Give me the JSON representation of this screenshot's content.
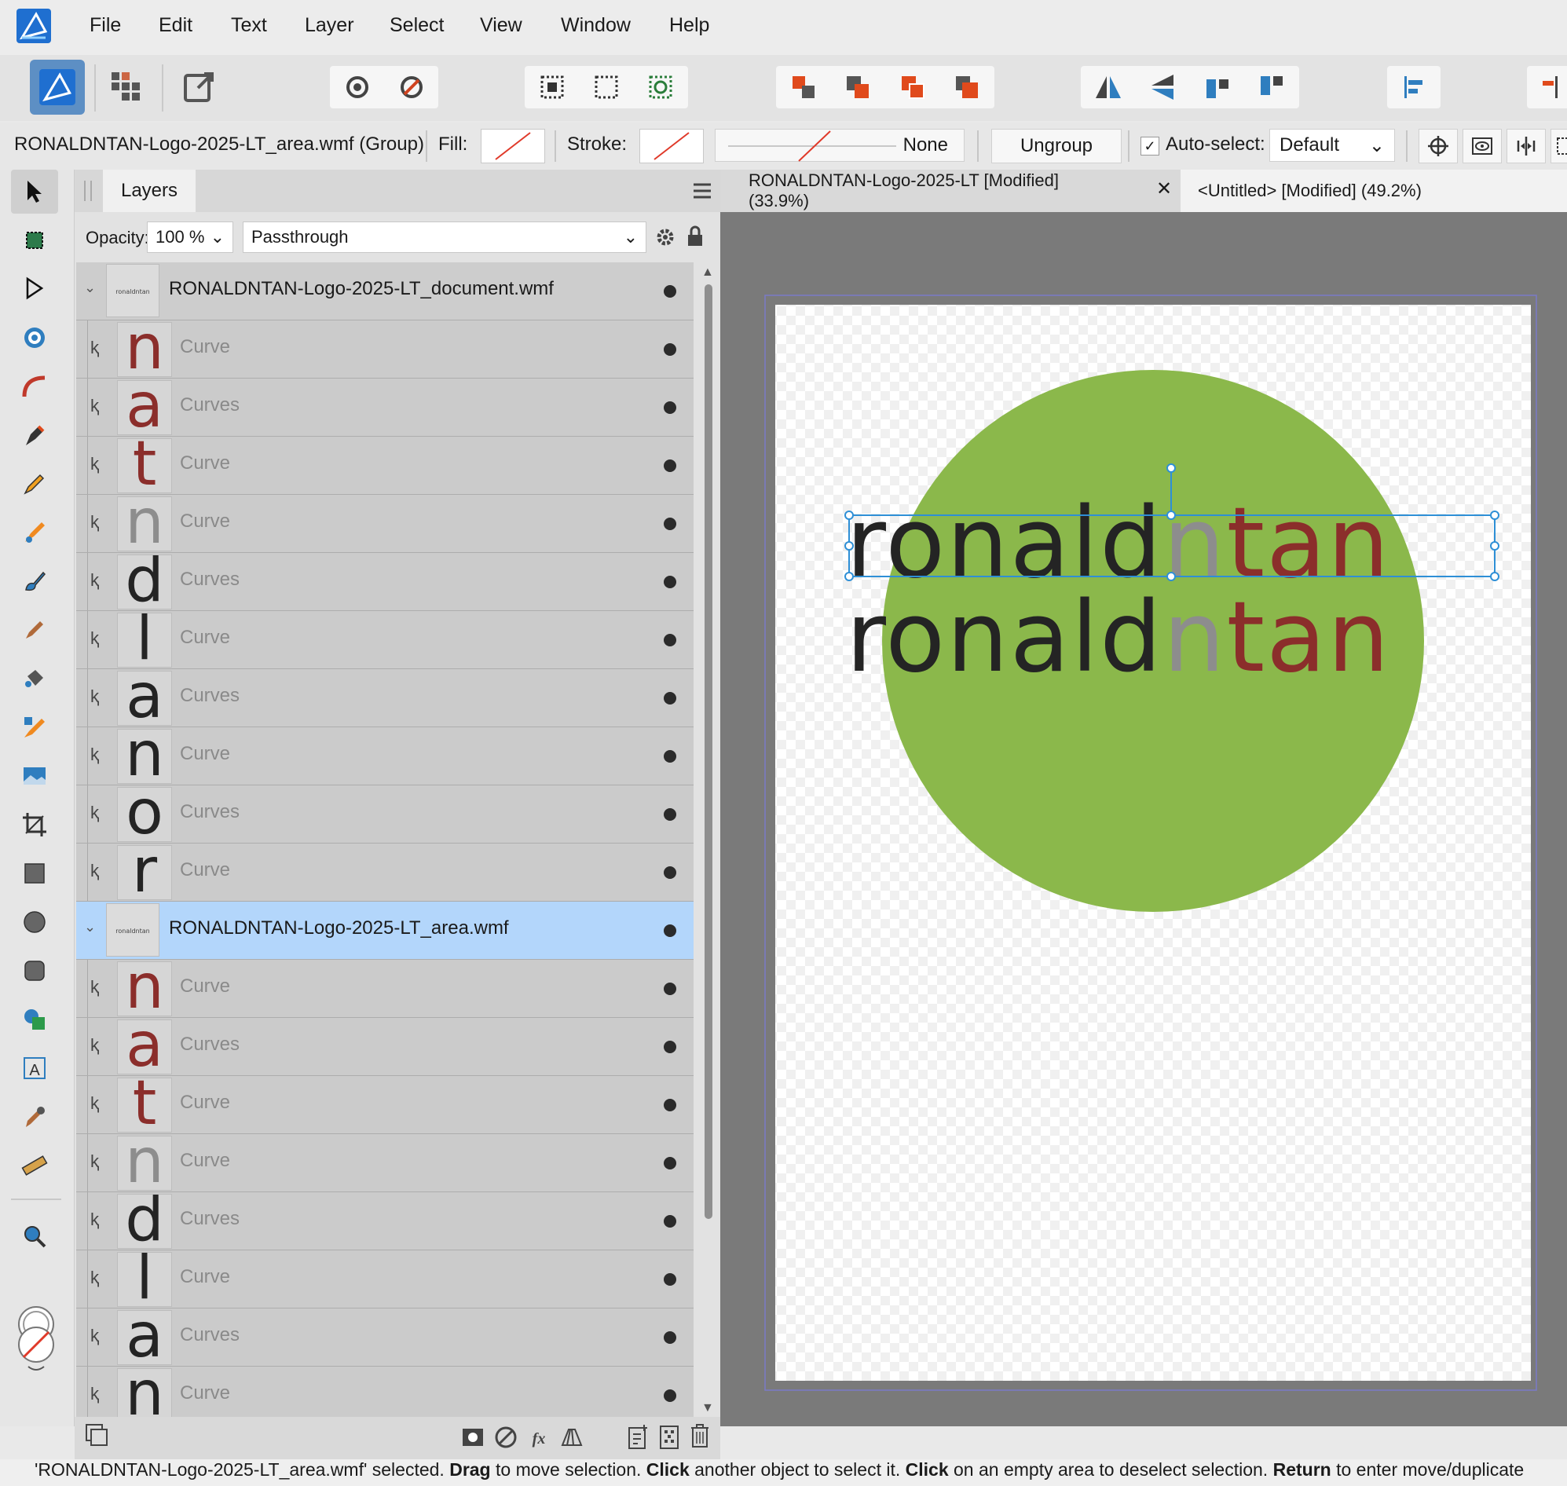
{
  "menu": [
    "File",
    "Edit",
    "Text",
    "Layer",
    "Select",
    "View",
    "Window",
    "Help"
  ],
  "context": {
    "selection": "RONALDNTAN-Logo-2025-LT_area.wmf (Group)",
    "fill_label": "Fill:",
    "stroke_label": "Stroke:",
    "stroke_style": "None",
    "ungroup": "Ungroup",
    "autoselect_label": "Auto-select:",
    "autoselect_value": "Default"
  },
  "layers": {
    "tab": "Layers",
    "opacity_label": "Opacity:",
    "opacity_value": "100 %",
    "blend_mode": "Passthrough",
    "rows": [
      {
        "name": "RONALDNTAN-Logo-2025-LT_document.wmf",
        "kind": "group",
        "thumb_text": "ronaldntan"
      },
      {
        "name": "Curve",
        "kind": "child",
        "glyph": "n",
        "color": "#8b2e2b"
      },
      {
        "name": "Curves",
        "kind": "child",
        "glyph": "a",
        "color": "#8b2e2b"
      },
      {
        "name": "Curve",
        "kind": "child",
        "glyph": "t",
        "color": "#8b2e2b"
      },
      {
        "name": "Curve",
        "kind": "child",
        "glyph": "n",
        "color": "#8d8d8d"
      },
      {
        "name": "Curves",
        "kind": "child",
        "glyph": "d",
        "color": "#242424"
      },
      {
        "name": "Curve",
        "kind": "child",
        "glyph": "l",
        "color": "#242424"
      },
      {
        "name": "Curves",
        "kind": "child",
        "glyph": "a",
        "color": "#242424"
      },
      {
        "name": "Curve",
        "kind": "child",
        "glyph": "n",
        "color": "#242424"
      },
      {
        "name": "Curves",
        "kind": "child",
        "glyph": "o",
        "color": "#242424"
      },
      {
        "name": "Curve",
        "kind": "child",
        "glyph": "r",
        "color": "#242424"
      },
      {
        "name": "RONALDNTAN-Logo-2025-LT_area.wmf",
        "kind": "group",
        "selected": true,
        "thumb_text": "ronaldntan"
      },
      {
        "name": "Curve",
        "kind": "child",
        "glyph": "n",
        "color": "#8b2e2b"
      },
      {
        "name": "Curves",
        "kind": "child",
        "glyph": "a",
        "color": "#8b2e2b"
      },
      {
        "name": "Curve",
        "kind": "child",
        "glyph": "t",
        "color": "#8b2e2b"
      },
      {
        "name": "Curve",
        "kind": "child",
        "glyph": "n",
        "color": "#8d8d8d"
      },
      {
        "name": "Curves",
        "kind": "child",
        "glyph": "d",
        "color": "#242424"
      },
      {
        "name": "Curve",
        "kind": "child",
        "glyph": "l",
        "color": "#242424"
      },
      {
        "name": "Curves",
        "kind": "child",
        "glyph": "a",
        "color": "#242424"
      },
      {
        "name": "Curve",
        "kind": "child",
        "glyph": "n",
        "color": "#242424"
      }
    ]
  },
  "documents": {
    "tab1": "RONALDNTAN-Logo-2025-LT [Modified] (33.9%)",
    "tab2": "<Untitled> [Modified] (49.2%)"
  },
  "artwork": {
    "logo_dark": "ronald",
    "logo_grey": "n",
    "logo_red": "tan",
    "circle_color": "#8bb84b",
    "dark_color": "#242424",
    "grey_color": "#8d8d8d",
    "red_color": "#8b2e2b"
  },
  "status": {
    "s1": "'RONALDNTAN-Logo-2025-LT_area.wmf' selected. ",
    "b1": "Drag",
    "s2": " to move selection. ",
    "b2": "Click",
    "s3": " another object to select it. ",
    "b3": "Click",
    "s4": " on an empty area to deselect selection. ",
    "b4": "Return",
    "s5": " to enter move/duplicate"
  },
  "colors": {
    "accent": "#2e8fd6",
    "selection_blue": "#b3d6fb",
    "red_orange": "#e04a1c"
  }
}
